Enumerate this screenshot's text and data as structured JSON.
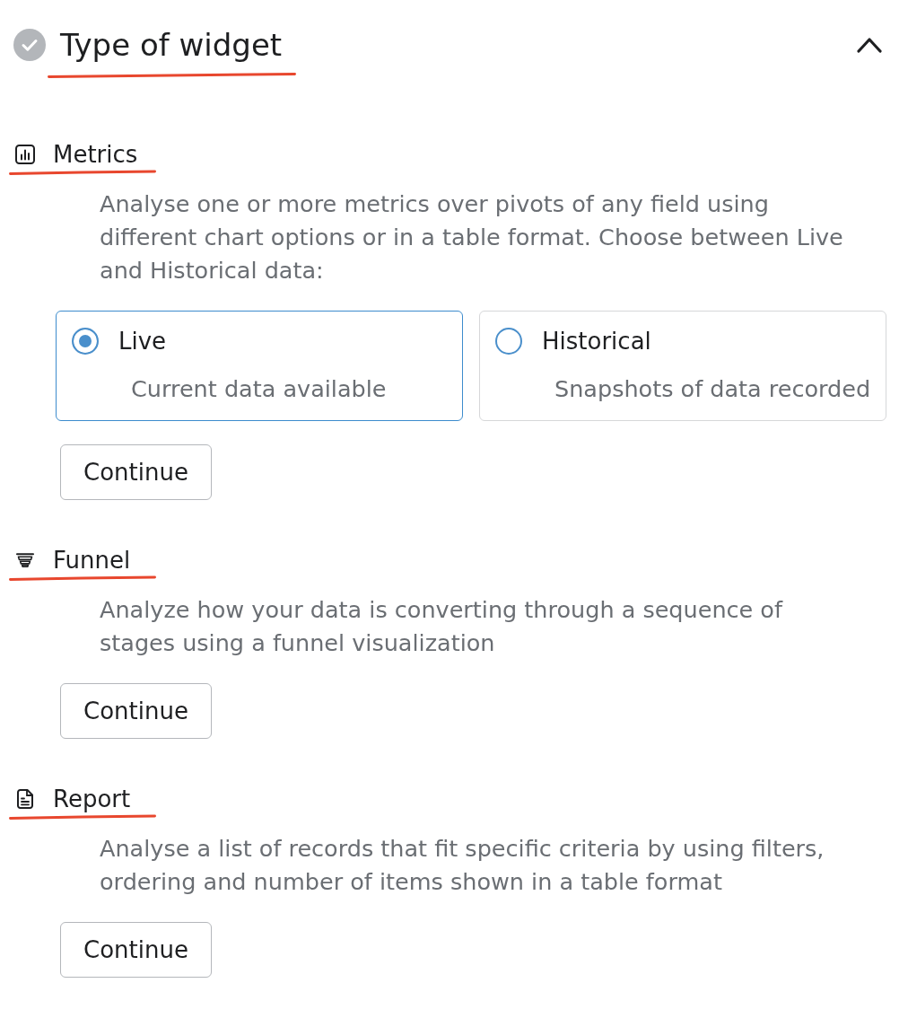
{
  "header": {
    "title": "Type of widget",
    "completed": true,
    "expanded": true,
    "underlined": true
  },
  "sections": [
    {
      "kind": "bars",
      "title": "Metrics",
      "underlined": true,
      "description": "Analyse one or more metrics over pivots of any field using different chart options or in a table format. Choose between Live and Historical data:",
      "options": [
        {
          "label": "Live",
          "caption": "Current data available",
          "selected": true
        },
        {
          "label": "Historical",
          "caption": "Snapshots of data recorded",
          "selected": false
        }
      ],
      "button": "Continue"
    },
    {
      "kind": "funnel",
      "title": "Funnel",
      "underlined": true,
      "description": "Analyze how your data is converting through a sequence of stages using a funnel visualization",
      "button": "Continue"
    },
    {
      "kind": "document",
      "title": "Report",
      "underlined": true,
      "description": "Analyse a list of records that fit specific criteria by using filters, ordering and number of items shown in a table format",
      "button": "Continue"
    }
  ]
}
